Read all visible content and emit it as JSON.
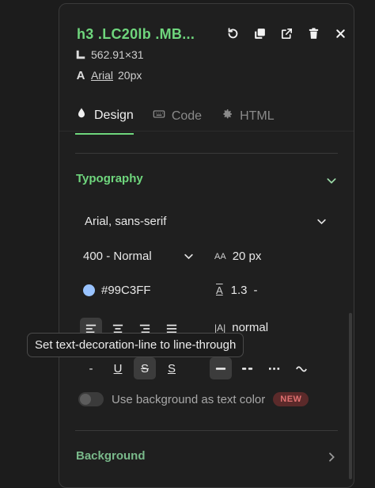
{
  "header": {
    "title": "h3 .LC20lb .MB...",
    "dimensions": "562.91×31",
    "font_family": "Arial",
    "font_size": "20px"
  },
  "tabs": [
    {
      "label": "Design",
      "icon": "droplet-icon",
      "active": true
    },
    {
      "label": "Code",
      "icon": "keyboard-icon",
      "active": false
    },
    {
      "label": "HTML",
      "icon": "gear-icon",
      "active": false
    }
  ],
  "typography": {
    "title": "Typography",
    "font_family_value": "Arial, sans-serif",
    "font_weight_value": "400 - Normal",
    "font_size_value": "20 px",
    "color_value": "#99C3FF",
    "line_height_value": "1.3",
    "line_height_unit": "-",
    "letter_spacing_value": "normal",
    "size_icon_text": "AA",
    "line_height_icon_text": "A",
    "letter_spacing_icon_text": "|A|",
    "decoration_none_text": "-",
    "decoration_underline_text": "U",
    "decoration_strike_text": "S",
    "decoration_overline_text": "S"
  },
  "toggle": {
    "label": "Use background as text color",
    "badge": "NEW"
  },
  "background": {
    "title": "Background"
  },
  "tooltip": {
    "text": "Set text-decoration-line to line-through"
  },
  "colors": {
    "accent": "#6fd67d",
    "swatch": "#99C3FF",
    "badge_bg": "#5b2a2a",
    "badge_text": "#e07070"
  }
}
